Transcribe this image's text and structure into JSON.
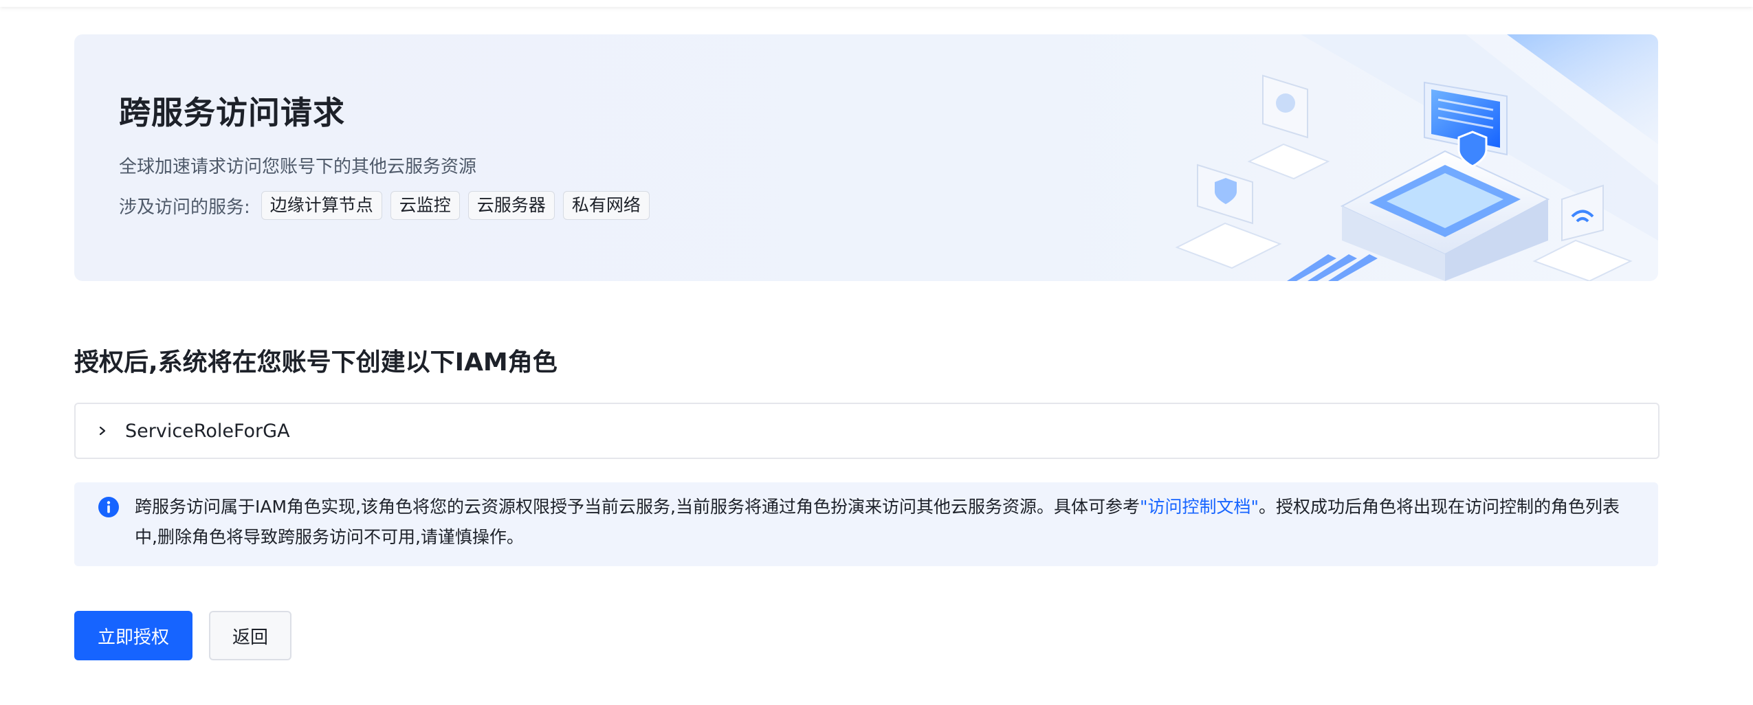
{
  "hero": {
    "title": "跨服务访问请求",
    "description": "全球加速请求访问您账号下的其他云服务资源",
    "services_label": "涉及访问的服务:",
    "services": [
      "边缘计算节点",
      "云监控",
      "云服务器",
      "私有网络"
    ]
  },
  "section": {
    "title": "授权后,系统将在您账号下创建以下IAM角色"
  },
  "role": {
    "name": "ServiceRoleForGA",
    "expand_icon": "chevron-right-icon"
  },
  "notice": {
    "icon": "info-icon",
    "text_before": "跨服务访问属于IAM角色实现,该角色将您的云资源权限授予当前云服务,当前服务将通过角色扮演来访问其他云服务资源。具体可参考",
    "link_text": "\"访问控制文档\"",
    "text_after": "。授权成功后角色将出现在访问控制的角色列表中,删除角色将导致跨服务访问不可用,请谨慎操作。"
  },
  "actions": {
    "authorize_label": "立即授权",
    "back_label": "返回"
  },
  "colors": {
    "primary": "#1664ff",
    "hero_bg": "#eef2fb",
    "notice_bg": "#f0f4fd",
    "text": "#1d2129",
    "secondary_text": "#4e5969"
  }
}
